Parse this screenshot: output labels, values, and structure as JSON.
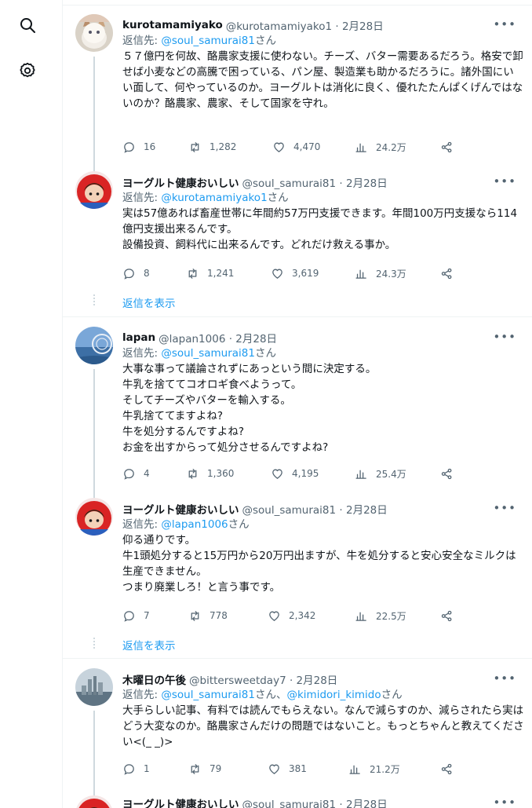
{
  "rail": {
    "search_icon": "search-icon",
    "settings_icon": "gear-icon"
  },
  "reply_prefix": "返信先: ",
  "reply_suffix": "さん",
  "reply_joiner": "、",
  "show_replies_label": "返信を表示",
  "tweets": [
    {
      "name": "kurotamamiyako",
      "handle": "@kurotamamiyako1 · 2月28日",
      "reply_to": [
        "@soul_samurai81"
      ],
      "text": "５７億円を何故、酪農家支援に使わない。チーズ、バター需要あるだろう。格安で卸せば小麦などの高騰で困っている、パン屋、製造業も助かるだろうに。諸外国にいい面して、何やっているのか。ヨーグルトは消化に良く、優れたたんぱくげんではないのか？酪農家、農家、そして国家を守れ。",
      "replies": "16",
      "retweets": "1,282",
      "likes": "4,470",
      "views": "24.2万"
    },
    {
      "name": "ヨーグルト健康おいしい",
      "handle": "@soul_samurai81 · 2月28日",
      "reply_to": [
        "@kurotamamiyako1"
      ],
      "text": "実は57億あれば畜産世帯に年間約57万円支援できます。年間100万円支援なら114億円支援出来るんです。\n設備投資、飼料代に出来るんです。どれだけ救える事か。",
      "replies": "8",
      "retweets": "1,241",
      "likes": "3,619",
      "views": "24.3万"
    },
    {
      "name": "lapan",
      "handle": "@lapan1006 · 2月28日",
      "reply_to": [
        "@soul_samurai81"
      ],
      "text": "大事な事って議論されずにあっという間に決定する。\n牛乳を捨ててコオロギ食べようって。\nそしてチーズやバターを輸入する。\n牛乳捨ててますよね?\n牛を処分するんですよね?\nお金を出すからって処分させるんですよね?",
      "replies": "4",
      "retweets": "1,360",
      "likes": "4,195",
      "views": "25.4万"
    },
    {
      "name": "ヨーグルト健康おいしい",
      "handle": "@soul_samurai81 · 2月28日",
      "reply_to": [
        "@lapan1006"
      ],
      "text": "仰る通りです。\n牛1頭処分すると15万円から20万円出ますが、牛を処分すると安心安全なミルクは生産できません。\nつまり廃業しろ！と言う事です。",
      "replies": "7",
      "retweets": "778",
      "likes": "2,342",
      "views": "22.5万"
    },
    {
      "name": "木曜日の午後",
      "handle": "@bittersweetday7 · 2月28日",
      "reply_to": [
        "@soul_samurai81",
        "@kimidori_kimido"
      ],
      "text": "大手らしい記事、有料では読んでもらえない。なんで減らすのか、減らされたら実はどう大変なのか。酪農家さんだけの問題ではないこと。もっとちゃんと教えてください<(_ _)>",
      "replies": "1",
      "retweets": "79",
      "likes": "381",
      "views": "21.2万"
    },
    {
      "name": "ヨーグルト健康おいしい",
      "handle": "@soul_samurai81 · 2月28日"
    }
  ]
}
